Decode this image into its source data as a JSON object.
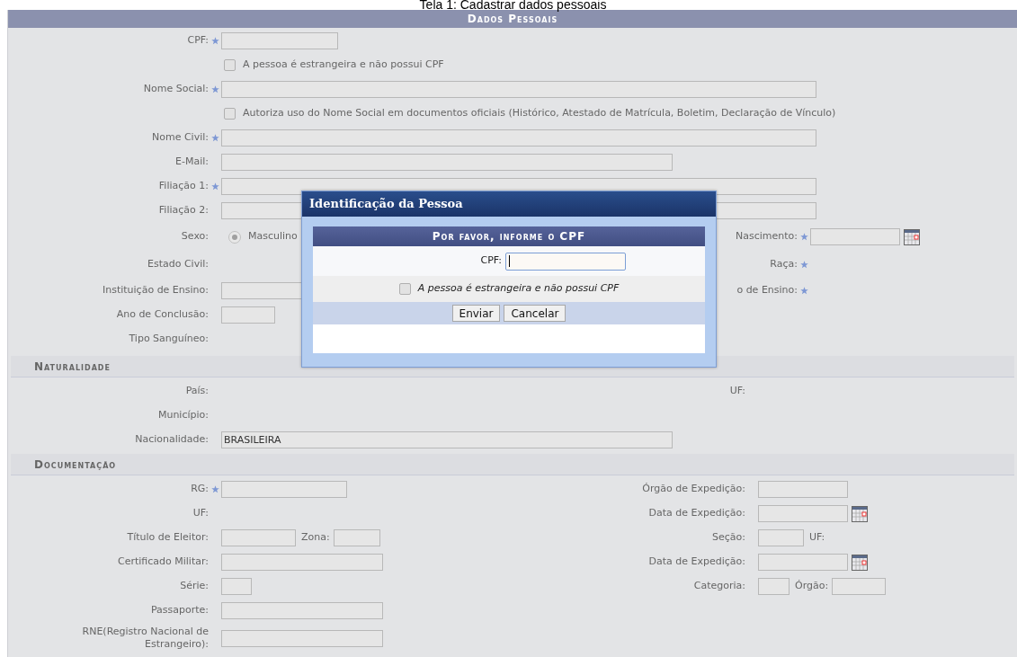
{
  "caption": "Tela 1: Cadastrar dados pessoais",
  "sections": [
    {
      "title": "Dados Pessoais",
      "kind": "main",
      "rows": [
        {
          "label": "CPF:",
          "required": true,
          "parts": [
            {
              "kind": "field"
            }
          ]
        },
        {
          "parts": [
            {
              "kind": "checkbox",
              "text": "A pessoa é estrangeira e não possui CPF",
              "checked": false
            }
          ]
        },
        {
          "label": "Nome Social:",
          "required": true,
          "parts": [
            {
              "kind": "field"
            }
          ]
        },
        {
          "parts": [
            {
              "kind": "checkbox",
              "text": "Autoriza uso do Nome Social em documentos oficiais (Histórico, Atestado de Matrícula, Boletim, Declaração de Vínculo)",
              "checked": false
            }
          ]
        },
        {
          "label": "Nome Civil:",
          "required": true,
          "parts": [
            {
              "kind": "field"
            }
          ]
        },
        {
          "label": "E-Mail:",
          "required": false,
          "parts": [
            {
              "kind": "field"
            }
          ]
        },
        {
          "label": "Filiação 1:",
          "required": true,
          "parts": [
            {
              "kind": "field"
            }
          ]
        },
        {
          "label": "Filiação 2:",
          "required": false,
          "parts": [
            {
              "kind": "field"
            }
          ]
        },
        {
          "label": "Sexo:",
          "required": false,
          "parts": [
            {
              "kind": "radio",
              "text": "Masculino",
              "selected": true
            }
          ],
          "right": {
            "label": "Nascimento:",
            "required": true,
            "parts": [
              {
                "kind": "date"
              }
            ]
          }
        },
        {
          "label": "Estado Civil:",
          "required": false,
          "parts": [],
          "right": {
            "label": "Raça:",
            "required": true
          }
        },
        {
          "label": "Instituição de Ensino:",
          "required": false,
          "parts": [
            {
              "kind": "field"
            }
          ],
          "right": {
            "label": "o de Ensino:",
            "required": true
          }
        },
        {
          "label": "Ano de Conclusão:",
          "required": false,
          "parts": [
            {
              "kind": "field"
            }
          ]
        },
        {
          "label": "Tipo Sanguíneo:",
          "required": false,
          "parts": []
        }
      ]
    },
    {
      "title": "Naturalidade",
      "kind": "sub",
      "rows": [
        {
          "label": "País:",
          "required": false,
          "parts": [],
          "right": {
            "label": "UF:",
            "required": false
          }
        },
        {
          "label": "Município:",
          "required": false,
          "parts": []
        },
        {
          "label": "Nacionalidade:",
          "required": false,
          "parts": [
            {
              "kind": "field",
              "value": "BRASILEIRA"
            }
          ]
        }
      ]
    },
    {
      "title": "Documentação",
      "kind": "sub",
      "rows": [
        {
          "label": "RG:",
          "required": true,
          "parts": [
            {
              "kind": "field"
            }
          ],
          "right": {
            "label": "Órgão de Expedição:",
            "required": false,
            "parts": [
              {
                "kind": "field"
              }
            ]
          }
        },
        {
          "label": "UF:",
          "required": false,
          "parts": [],
          "right": {
            "label": "Data de Expedição:",
            "required": false,
            "parts": [
              {
                "kind": "date"
              }
            ]
          }
        },
        {
          "label": "Título de Eleitor:",
          "required": false,
          "parts": [
            {
              "kind": "field"
            },
            {
              "kind": "label",
              "text": "Zona:"
            },
            {
              "kind": "field"
            }
          ],
          "right": {
            "label": "Seção:",
            "required": false,
            "parts": [
              {
                "kind": "field"
              },
              {
                "kind": "label",
                "text": "UF:"
              }
            ]
          }
        },
        {
          "label": "Certificado Militar:",
          "required": false,
          "parts": [
            {
              "kind": "field"
            }
          ],
          "right": {
            "label": "Data de Expedição:",
            "required": false,
            "parts": [
              {
                "kind": "date"
              }
            ]
          }
        },
        {
          "label": "Série:",
          "required": false,
          "parts": [
            {
              "kind": "field"
            }
          ],
          "right": {
            "label": "Categoria:",
            "required": false,
            "parts": [
              {
                "kind": "field"
              },
              {
                "kind": "label",
                "text": "Órgão:"
              },
              {
                "kind": "field"
              }
            ]
          }
        },
        {
          "label": "Passaporte:",
          "required": false,
          "parts": [
            {
              "kind": "field"
            }
          ]
        },
        {
          "label": "RNE(Registro Nacional de Estrangeiro):",
          "required": false,
          "parts": [
            {
              "kind": "field"
            }
          ]
        }
      ]
    }
  ],
  "dialog": {
    "title": "Identificação da Pessoa",
    "heading": "Por favor, informe o CPF",
    "field_label": "CPF:",
    "checkbox": {
      "text": "A pessoa é estrangeira e não possui CPF",
      "checked": false
    },
    "buttons": [
      "Enviar",
      "Cancelar"
    ]
  }
}
